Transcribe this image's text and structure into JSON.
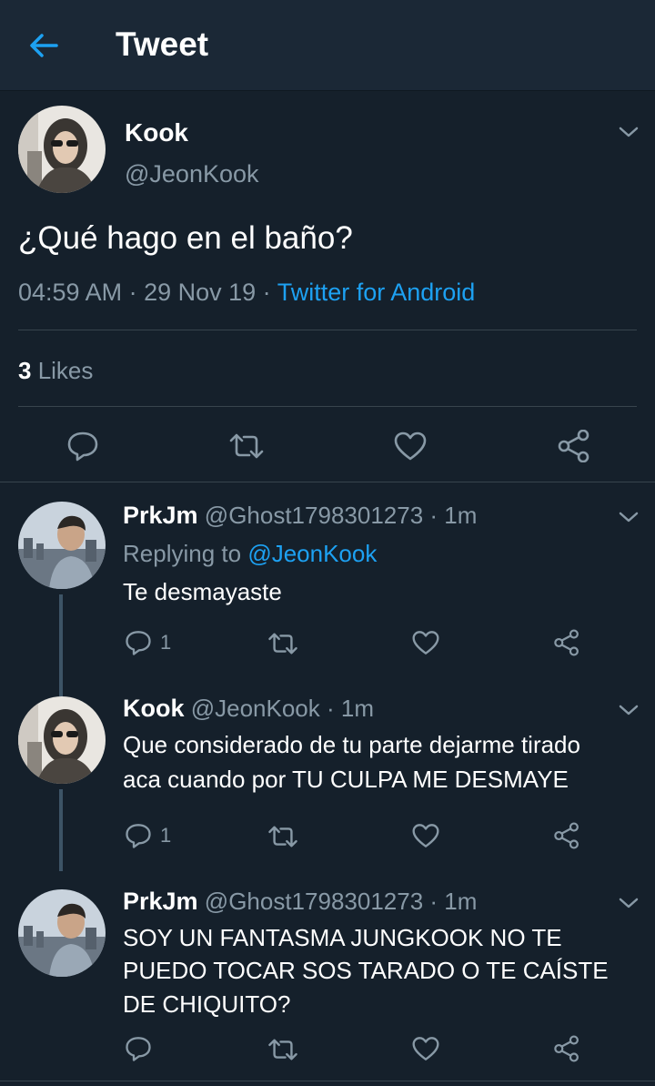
{
  "header": {
    "title": "Tweet",
    "back_icon": "arrow-left-icon",
    "accent": "#1da1f2"
  },
  "main_tweet": {
    "name": "Kook",
    "handle": "@JeonKook",
    "text": "¿Qué hago en el baño?",
    "time": "04:59 AM",
    "sep1": " · ",
    "date": "29 Nov 19",
    "sep2": " · ",
    "source": "Twitter for Android",
    "likes_count": "3",
    "likes_label": " Likes"
  },
  "replies": [
    {
      "name": "PrkJm",
      "handle": "@Ghost1798301273",
      "time": "· 1m",
      "replying_prefix": "Replying to ",
      "replying_to": "@JeonKook",
      "lines": [
        "Te desmayaste"
      ],
      "reply_count": "1"
    },
    {
      "name": "Kook",
      "handle": "@JeonKook",
      "time": "· 1m",
      "lines": [
        "Que considerado de tu parte dejarme tirado",
        "aca cuando por TU CULPA ME DESMAYE"
      ],
      "reply_count": "1"
    },
    {
      "name": "PrkJm",
      "handle": "@Ghost1798301273",
      "time": "· 1m",
      "lines": [
        "SOY UN FANTASMA JUNGKOOK NO TE",
        "PUEDO TOCAR SOS TARADO O TE CAÍSTE",
        "DE CHIQUITO?"
      ],
      "reply_count": ""
    }
  ]
}
